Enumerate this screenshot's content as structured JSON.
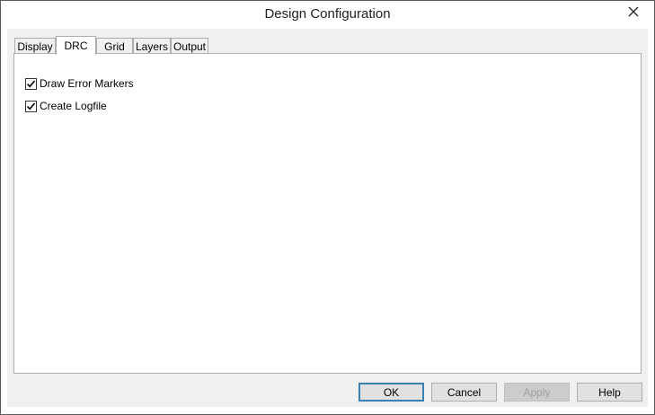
{
  "window": {
    "title": "Design Configuration",
    "close_icon": "close-icon"
  },
  "tabs": [
    {
      "label": "Display",
      "active": false
    },
    {
      "label": "DRC",
      "active": true
    },
    {
      "label": "Grid",
      "active": false
    },
    {
      "label": "Layers",
      "active": false
    },
    {
      "label": "Output",
      "active": false
    }
  ],
  "drc": {
    "options": [
      {
        "label": "Draw Error Markers",
        "checked": true
      },
      {
        "label": "Create Logfile",
        "checked": true
      }
    ]
  },
  "buttons": {
    "ok": "OK",
    "cancel": "Cancel",
    "apply": "Apply",
    "help": "Help"
  }
}
